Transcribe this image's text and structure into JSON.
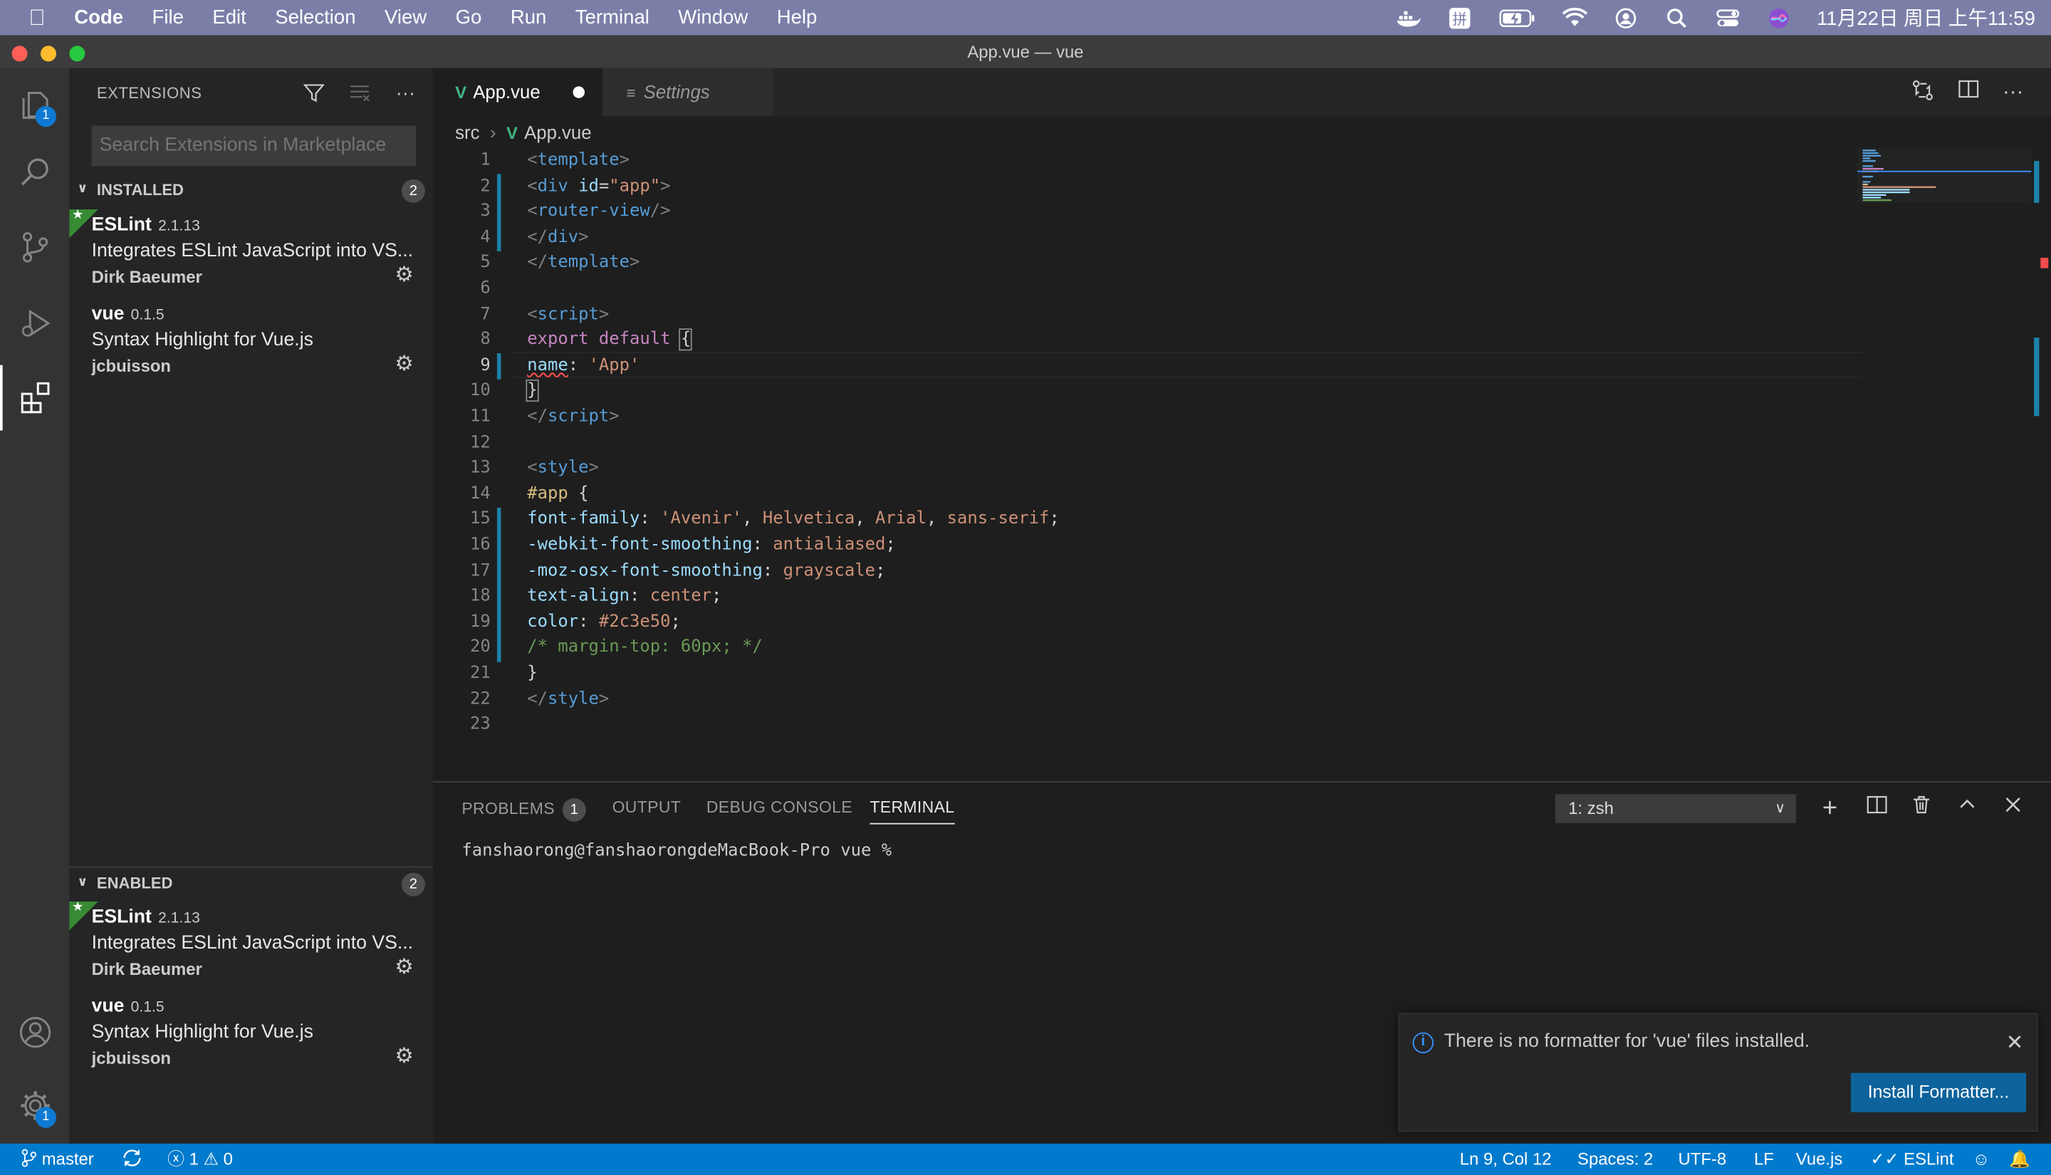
{
  "menubar": {
    "apple_icon": "apple-logo",
    "app": "Code",
    "items": [
      "File",
      "Edit",
      "Selection",
      "View",
      "Go",
      "Run",
      "Terminal",
      "Window",
      "Help"
    ],
    "clock": "11月22日 周日 上午11:59"
  },
  "window": {
    "title": "App.vue — vue"
  },
  "activity": {
    "explorer_badge": "1",
    "settings_badge": "1"
  },
  "sidebar": {
    "title": "EXTENSIONS",
    "search_placeholder": "Search Extensions in Marketplace",
    "installed": {
      "label": "INSTALLED",
      "count": "2",
      "items": [
        {
          "name": "ESLint",
          "version": "2.1.13",
          "description": "Integrates ESLint JavaScript into VS...",
          "publisher": "Dirk Baeumer"
        },
        {
          "name": "vue",
          "version": "0.1.5",
          "description": "Syntax Highlight for Vue.js",
          "publisher": "jcbuisson"
        }
      ]
    },
    "enabled": {
      "label": "ENABLED",
      "count": "2",
      "items": [
        {
          "name": "ESLint",
          "version": "2.1.13",
          "description": "Integrates ESLint JavaScript into VS...",
          "publisher": "Dirk Baeumer"
        },
        {
          "name": "vue",
          "version": "0.1.5",
          "description": "Syntax Highlight for Vue.js",
          "publisher": "jcbuisson"
        }
      ]
    }
  },
  "editor": {
    "tabs": [
      {
        "label": "App.vue"
      },
      {
        "label": "Settings"
      }
    ],
    "breadcrumb": {
      "folder": "src",
      "file": "App.vue"
    },
    "line_numbers": [
      "1",
      "2",
      "3",
      "4",
      "5",
      "6",
      "7",
      "8",
      "9",
      "10",
      "11",
      "12",
      "13",
      "14",
      "15",
      "16",
      "17",
      "18",
      "19",
      "20",
      "21",
      "22",
      "23"
    ]
  },
  "panel": {
    "tabs": {
      "problems": "PROBLEMS",
      "problems_count": "1",
      "output": "OUTPUT",
      "debug": "DEBUG CONSOLE",
      "terminal": "TERMINAL"
    },
    "terminal_select": "1: zsh",
    "prompt": "fanshaorong@fanshaorongdeMacBook-Pro vue % "
  },
  "notification": {
    "message": "There is no formatter for 'vue' files installed.",
    "button": "Install Formatter..."
  },
  "statusbar": {
    "branch": "master",
    "errors": "1",
    "warnings": "0",
    "position": "Ln 9, Col 12",
    "spaces": "Spaces: 2",
    "encoding": "UTF-8",
    "eol": "LF",
    "language": "Vue.js",
    "eslint": "ESLint"
  },
  "colors": {
    "accent": "#007acc",
    "menubar": "#7b7fa8",
    "vue_green": "#41b883"
  }
}
